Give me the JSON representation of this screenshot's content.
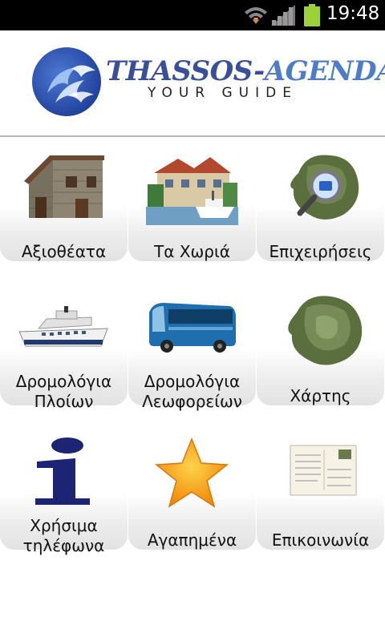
{
  "status_bar": {
    "time": "19:48"
  },
  "header": {
    "brand_left": "THASSOS-",
    "brand_right": "AGENDA",
    "tagline": "YOUR GUIDE"
  },
  "tiles": [
    {
      "label": "Αξιοθέατα"
    },
    {
      "label": "Τα Χωριά"
    },
    {
      "label": "Επιχειρήσεις"
    },
    {
      "label_line1": "Δρομολόγια",
      "label_line2": "Πλοίων"
    },
    {
      "label_line1": "Δρομολόγια",
      "label_line2": "Λεωφορείων"
    },
    {
      "label": "Χάρτης"
    },
    {
      "label_line1": "Χρήσιμα",
      "label_line2": "τηλέφωνα"
    },
    {
      "label": "Αγαπημένα"
    },
    {
      "label": "Επικοινωνία"
    }
  ]
}
